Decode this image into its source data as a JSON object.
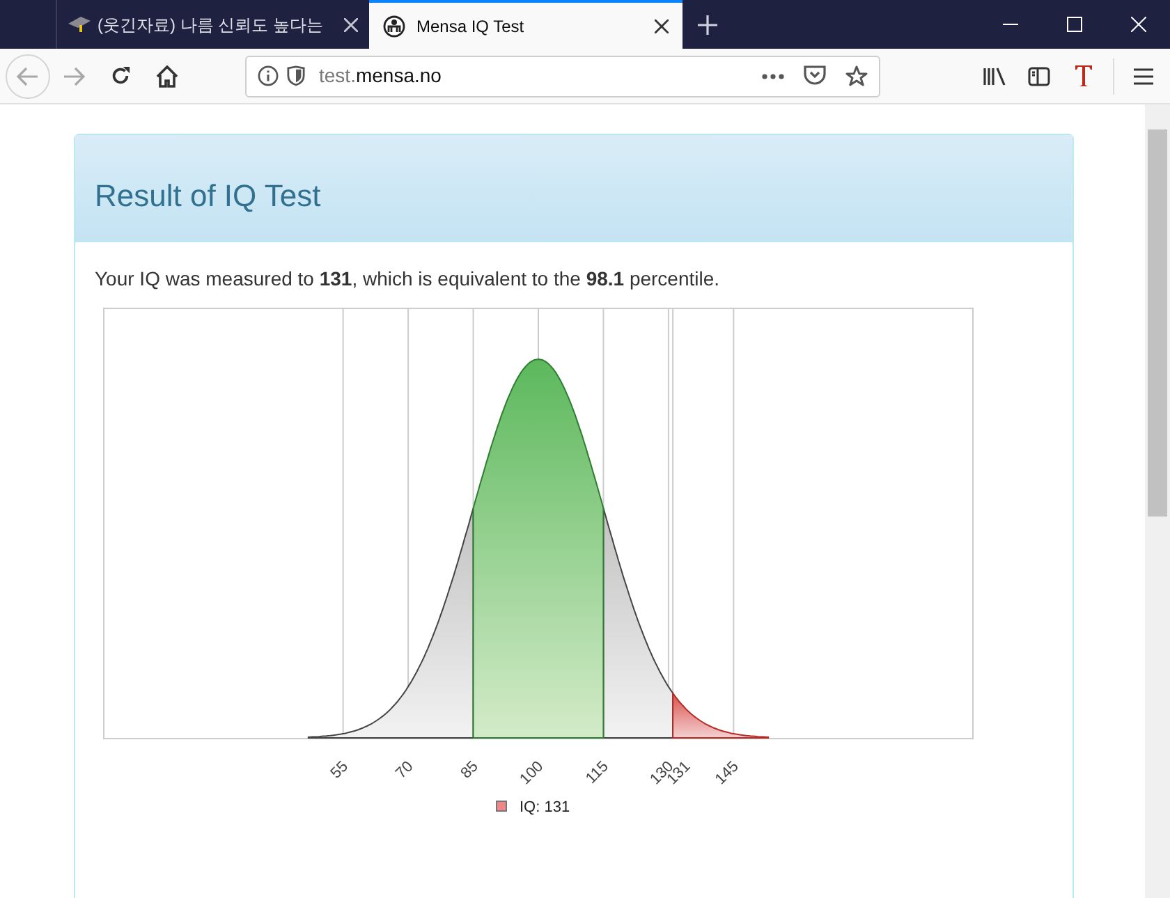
{
  "tabs": [
    {
      "title": "(웃긴자료) 나름 신뢰도 높다는",
      "selected": false
    },
    {
      "title": "Mensa IQ Test",
      "selected": true
    }
  ],
  "address_bar": {
    "host_prefix": "test.",
    "domain": "mensa.no"
  },
  "panel": {
    "title": "Result of IQ Test",
    "summary": "Your IQ was measured to **131**, which is equivalent to the **98.1** percentile."
  },
  "chart": {
    "x_labels": [
      "55",
      "70",
      "85",
      "100",
      "115",
      "130",
      "131",
      "145"
    ],
    "legend": "IQ: 131"
  }
}
